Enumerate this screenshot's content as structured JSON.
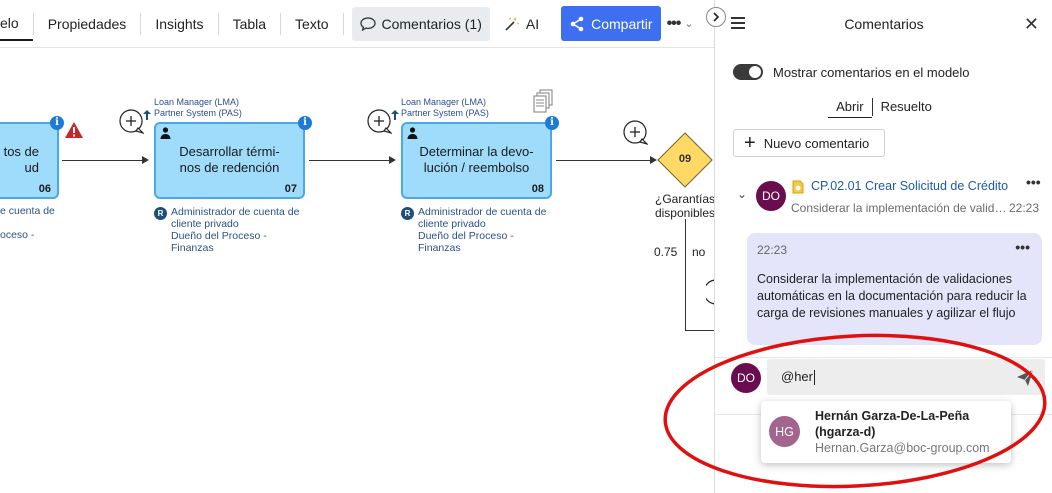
{
  "toolbar": {
    "tabs": [
      {
        "label": "elo"
      },
      {
        "label": "Propiedades"
      },
      {
        "label": "Insights"
      },
      {
        "label": "Tabla"
      },
      {
        "label": "Texto"
      }
    ],
    "comments_tab": "Comentarios (1)",
    "ai_tab": "AI",
    "share_button": "Compartir",
    "more": "•••"
  },
  "canvas": {
    "tasks": [
      {
        "name": "tos de\nud",
        "number": "06"
      },
      {
        "name": "Desarrollar térmi-\nnos de redención",
        "number": "07",
        "systems": "Loan Manager (LMA)\nPartner System (PAS)",
        "role": "Administrador de cuenta de\ncliente privado",
        "owner": "Dueño del Proceso -\nFinanzas"
      },
      {
        "name": "Determinar la devo-\nlución / reembolso",
        "number": "08",
        "systems": "Loan Manager (LMA)\nPartner System (PAS)",
        "role": "Administrador de cuenta de\ncliente privado",
        "owner": "Dueño del Proceso -\nFinanzas"
      }
    ],
    "partial_role": "e cuenta de",
    "partial_owner": "oceso -",
    "gateway": {
      "number": "09",
      "label": "¿Garantías\ndisponibles"
    },
    "edge_probability": "0.75",
    "edge_label": "no"
  },
  "panel": {
    "title": "Comentarios",
    "toggle_label": "Mostrar comentarios en el modelo",
    "segment": {
      "open": "Abrir",
      "resolved": "Resuelto"
    },
    "new_comment": "Nuevo comentario",
    "thread": {
      "avatar": "DO",
      "title": "CP.02.01 Crear Solicitud de Crédito",
      "preview": "Considerar la implementación de validaciones automáticas",
      "time": "22:23"
    },
    "message": {
      "time": "22:23",
      "text": "Considerar la implementación de validaciones automáticas en la documentación para reducir la carga de revisiones manuales y agilizar el flujo"
    },
    "compose": {
      "avatar": "DO",
      "value": "@her"
    },
    "mention_suggestion": {
      "initials": "HG",
      "name": "Hernán Garza-De-La-Peña",
      "handle": "(hgarza-d)",
      "email": "Hernan.Garza@boc-group.com"
    }
  },
  "colors": {
    "task_fill": "#9fdcfb",
    "task_border": "#4aa8e8",
    "gateway_fill": "#ffd966",
    "share_blue": "#3d6ff0",
    "avatar_do": "#6a0d4f",
    "avatar_hg": "#a3648e",
    "message_bg": "#e4e5fa",
    "annotation_red": "#e01010"
  }
}
